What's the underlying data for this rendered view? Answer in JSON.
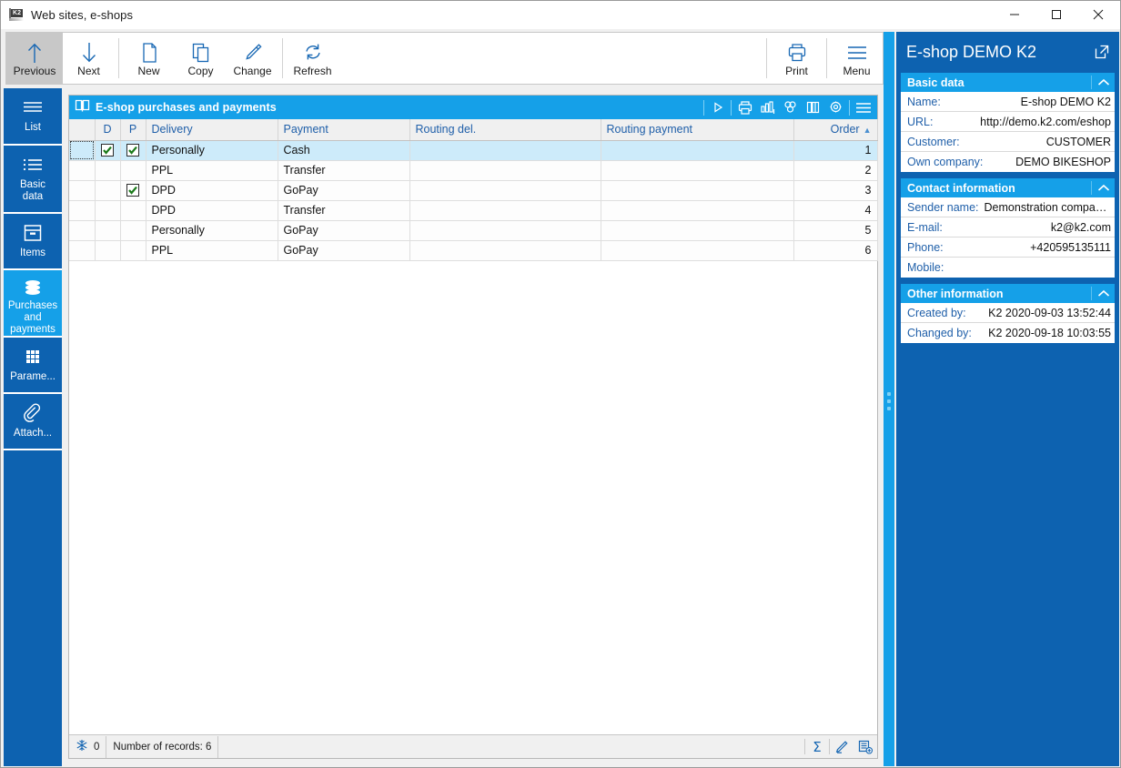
{
  "window": {
    "title": "Web sites, e-shops",
    "icon": "k2-app-icon",
    "controls": {
      "minimize": "minimize-icon",
      "maximize": "maximize-icon",
      "close": "close-icon"
    }
  },
  "toolbar": {
    "items": [
      {
        "label": "Previous",
        "icon": "arrow-up-icon",
        "selected": true
      },
      {
        "label": "Next",
        "icon": "arrow-down-icon",
        "selected": false
      },
      {
        "label": "New",
        "icon": "new-document-icon",
        "selected": false
      },
      {
        "label": "Copy",
        "icon": "copy-icon",
        "selected": false
      },
      {
        "label": "Change",
        "icon": "pencil-icon",
        "selected": false
      },
      {
        "label": "Refresh",
        "icon": "refresh-icon",
        "selected": false
      }
    ],
    "right_items": [
      {
        "label": "Print",
        "icon": "printer-icon"
      },
      {
        "label": "Menu",
        "icon": "hamburger-menu-icon"
      }
    ]
  },
  "sidebar": {
    "items": [
      {
        "label": "List",
        "icon": "list-lines-icon",
        "active": false
      },
      {
        "label": "Basic\ndata",
        "label_line1": "Basic",
        "label_line2": "data",
        "icon": "bullet-list-icon",
        "active": false
      },
      {
        "label": "Items",
        "icon": "box-icon",
        "active": false
      },
      {
        "label": "Purchases and payments",
        "icon": "layers-icon",
        "active": true
      },
      {
        "label": "Parame...",
        "icon": "grid-dots-icon",
        "active": false
      },
      {
        "label": "Attach...",
        "icon": "paperclip-icon",
        "active": false
      }
    ]
  },
  "grid": {
    "header_title": "E-shop purchases and payments",
    "header_icon": "book-icon",
    "header_tools": [
      {
        "icon": "play-triangle-icon"
      },
      {
        "icon": "printer-icon"
      },
      {
        "icon": "bar-chart-icon"
      },
      {
        "icon": "pivot-cubes-icon"
      },
      {
        "icon": "columns-icon"
      },
      {
        "icon": "settings-gear-icon"
      },
      {
        "icon": "hamburger-menu-icon"
      }
    ],
    "columns": [
      "",
      "D",
      "P",
      "Delivery",
      "Payment",
      "Routing del.",
      "Routing payment",
      "Order"
    ],
    "sort_column": "Order",
    "sort_direction": "asc",
    "rows": [
      {
        "d": true,
        "p": true,
        "delivery": "Personally",
        "payment": "Cash",
        "routing_del": "",
        "routing_payment": "",
        "order": "1",
        "selected": true
      },
      {
        "d": false,
        "p": false,
        "delivery": "PPL",
        "payment": "Transfer",
        "routing_del": "",
        "routing_payment": "",
        "order": "2",
        "selected": false
      },
      {
        "d": false,
        "p": true,
        "delivery": "DPD",
        "payment": "GoPay",
        "routing_del": "",
        "routing_payment": "",
        "order": "3",
        "selected": false
      },
      {
        "d": false,
        "p": false,
        "delivery": "DPD",
        "payment": "Transfer",
        "routing_del": "",
        "routing_payment": "",
        "order": "4",
        "selected": false
      },
      {
        "d": false,
        "p": false,
        "delivery": "Personally",
        "payment": "GoPay",
        "routing_del": "",
        "routing_payment": "",
        "order": "5",
        "selected": false
      },
      {
        "d": false,
        "p": false,
        "delivery": "PPL",
        "payment": "GoPay",
        "routing_del": "",
        "routing_payment": "",
        "order": "6",
        "selected": false
      }
    ],
    "status": {
      "snowflake_icon": "snowflake-icon",
      "snowflake_count": "0",
      "record_count_text": "Number of records: 6",
      "right_icons": [
        {
          "icon": "sum-sigma-icon"
        },
        {
          "icon": "pencil-edit-icon"
        },
        {
          "icon": "new-record-icon"
        }
      ]
    }
  },
  "splitter": {
    "icon": "splitter-dots-icon"
  },
  "infopanel": {
    "title": "E-shop DEMO K2",
    "open_icon": "open-external-icon",
    "sections": [
      {
        "title": "Basic data",
        "caret": "chevron-up-icon",
        "rows": [
          {
            "label": "Name:",
            "value": "E-shop DEMO K2"
          },
          {
            "label": "URL:",
            "value": "http://demo.k2.com/eshop"
          },
          {
            "label": "Customer:",
            "value": "CUSTOMER"
          },
          {
            "label": "Own company:",
            "value": "DEMO BIKESHOP"
          }
        ]
      },
      {
        "title": "Contact information",
        "caret": "chevron-up-icon",
        "rows": [
          {
            "label": "Sender name:",
            "value": "Demonstration company ..."
          },
          {
            "label": "E-mail:",
            "value": "k2@k2.com"
          },
          {
            "label": "Phone:",
            "value": "+420595135111"
          },
          {
            "label": "Mobile:",
            "value": ""
          }
        ]
      },
      {
        "title": "Other information",
        "caret": "chevron-up-icon",
        "rows": [
          {
            "label": "Created by:",
            "value": "K2 2020-09-03 13:52:44"
          },
          {
            "label": "Changed by:",
            "value": "K2 2020-09-18 10:03:55"
          }
        ]
      }
    ]
  },
  "colors": {
    "accent_blue": "#15a0e8",
    "panel_blue": "#0d62b0",
    "link_blue": "#1f5fa9",
    "selection_blue": "#cdebfa",
    "check_green": "#1a7a1a"
  }
}
